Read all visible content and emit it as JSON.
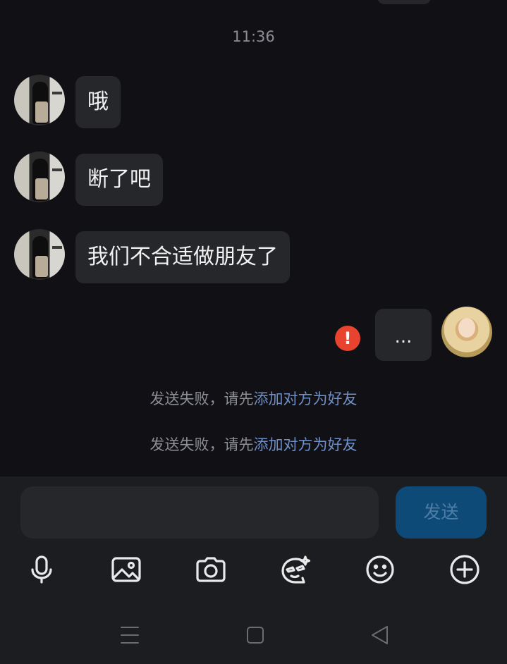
{
  "chat": {
    "timestamp": "11:36",
    "messages_left": [
      {
        "text": "哦"
      },
      {
        "text": "断了吧"
      },
      {
        "text": "我们不合适做朋友了"
      }
    ],
    "message_right": {
      "text": "..."
    },
    "error_mark": "!",
    "system_notes": [
      {
        "prefix": "发送失败，请先",
        "link": "添加对方为好友"
      },
      {
        "prefix": "发送失败，请先",
        "link": "添加对方为好友"
      }
    ]
  },
  "composer": {
    "input_value": "",
    "send_label": "发送"
  },
  "toolbar": {
    "items": [
      "microphone-icon",
      "image-icon",
      "camera-icon",
      "sticker-icon",
      "emoji-icon",
      "plus-icon"
    ]
  },
  "navbar": {
    "items": [
      "menu-icon",
      "home-icon",
      "back-icon"
    ]
  },
  "colors": {
    "background": "#111115",
    "bubble": "#26272b",
    "link": "#6e8fc8",
    "error": "#e8432f",
    "send_button": "#0e4a78"
  }
}
